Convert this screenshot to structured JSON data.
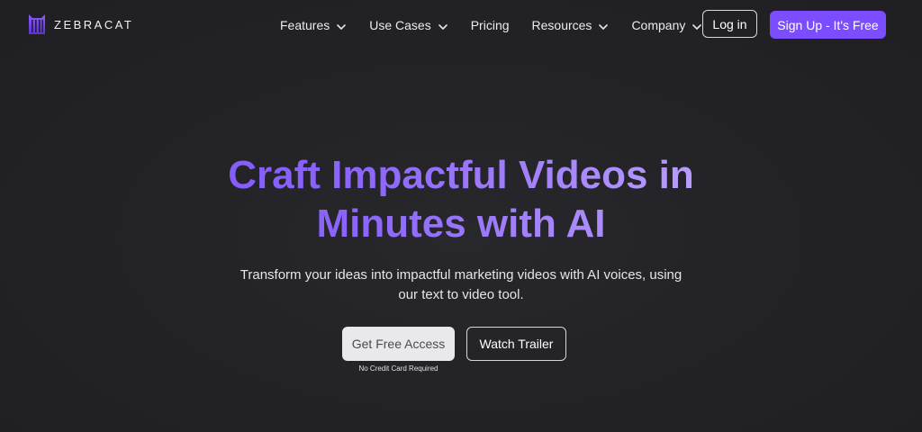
{
  "brand": {
    "name": "ZEBRACAT",
    "logo_icon": "zebracat-logo-icon",
    "accent_color": "#7c4dff"
  },
  "nav": {
    "items": [
      {
        "label": "Features",
        "has_dropdown": true
      },
      {
        "label": "Use Cases",
        "has_dropdown": true
      },
      {
        "label": "Pricing",
        "has_dropdown": false
      },
      {
        "label": "Resources",
        "has_dropdown": true
      },
      {
        "label": "Company",
        "has_dropdown": true
      }
    ],
    "login_label": "Log in",
    "signup_label": "Sign Up - It's Free"
  },
  "hero": {
    "title_line1": "Craft Impactful Videos in",
    "title_line2": "Minutes with AI",
    "subtitle_line1": "Transform your ideas into impactful marketing videos with AI voices, using",
    "subtitle_line2": "our text to video tool.",
    "primary_cta": "Get Free Access",
    "secondary_cta": "Watch Trailer",
    "cta_note": "No Credit Card Required"
  }
}
